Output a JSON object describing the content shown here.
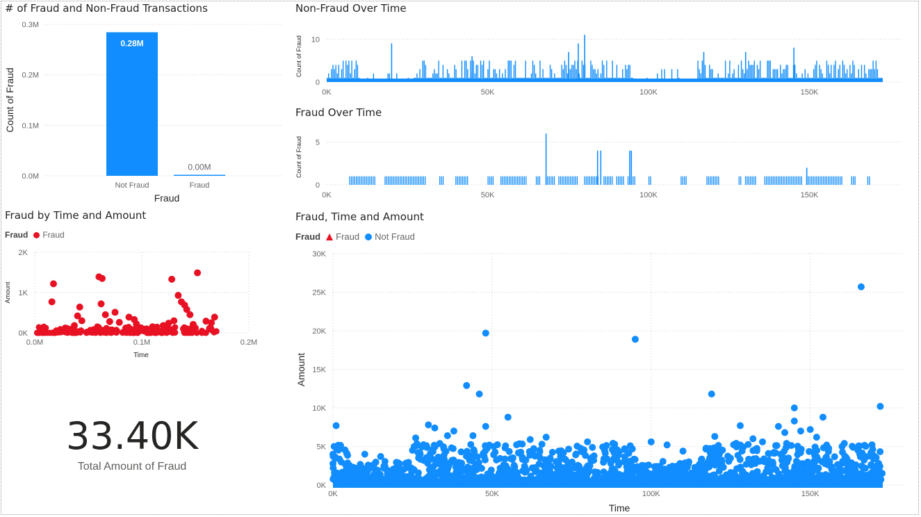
{
  "colors": {
    "blue": "#118dff",
    "red": "#e81123",
    "grid": "#c8c8c8"
  },
  "visuals": {
    "bar_title": "# of Fraud and Non-Fraud Transactions",
    "nonfraud_title": "Non-Fraud Over Time",
    "fraud_title": "Fraud Over Time",
    "fraud_scatter_title": "Fraud by Time and Amount",
    "main_scatter_title": "Fraud, Time and Amount"
  },
  "legend_small": {
    "title": "Fraud",
    "items": [
      {
        "label": "Fraud",
        "shape": "circle",
        "color": "#e81123"
      }
    ]
  },
  "legend_main": {
    "title": "Fraud",
    "items": [
      {
        "label": "Fraud",
        "shape": "triangle",
        "color": "#e81123"
      },
      {
        "label": "Not Fraud",
        "shape": "circle",
        "color": "#118dff"
      }
    ]
  },
  "kpi": {
    "value": "33.40K",
    "label": "Total Amount of Fraud"
  },
  "chart_data": [
    {
      "id": "bar",
      "type": "bar",
      "title": "# of Fraud and Non-Fraud Transactions",
      "categories": [
        "Not Fraud",
        "Fraud"
      ],
      "values": [
        284315,
        492
      ],
      "data_labels": [
        "0.28M",
        "0.00M"
      ],
      "xlabel": "Fraud",
      "ylabel": "Count of Fraud",
      "ylim": [
        0,
        300000
      ],
      "yticks": [
        {
          "v": 0,
          "t": "0.0M"
        },
        {
          "v": 100000,
          "t": "0.1M"
        },
        {
          "v": 200000,
          "t": "0.2M"
        },
        {
          "v": 300000,
          "t": "0.3M"
        }
      ],
      "grid": true
    },
    {
      "id": "nonfraud",
      "type": "bar",
      "title": "Non-Fraud Over Time",
      "xlabel": "",
      "ylabel": "Count of Fraud",
      "xlim": [
        0,
        172792
      ],
      "ylim": [
        0,
        12
      ],
      "xticks": [
        {
          "v": 0,
          "t": "0K"
        },
        {
          "v": 50000,
          "t": "50K"
        },
        {
          "v": 100000,
          "t": "100K"
        },
        {
          "v": 150000,
          "t": "150K"
        }
      ],
      "yticks": [
        {
          "v": 0,
          "t": "0"
        },
        {
          "v": 10,
          "t": "10"
        }
      ],
      "spikes": [
        [
          20000,
          9
        ],
        [
          80000,
          11
        ],
        [
          78000,
          9
        ],
        [
          145000,
          8
        ],
        [
          130000,
          7
        ],
        [
          117000,
          7
        ],
        [
          75000,
          7
        ],
        [
          45000,
          6
        ]
      ],
      "grid": true
    },
    {
      "id": "fraud",
      "type": "bar",
      "title": "Fraud Over Time",
      "xlabel": "",
      "ylabel": "Count of Fraud",
      "xlim": [
        0,
        172792
      ],
      "ylim": [
        0,
        6.5
      ],
      "xticks": [
        {
          "v": 0,
          "t": "0K"
        },
        {
          "v": 50000,
          "t": "50K"
        },
        {
          "v": 100000,
          "t": "100K"
        },
        {
          "v": 150000,
          "t": "150K"
        }
      ],
      "yticks": [
        {
          "v": 0,
          "t": "0"
        },
        {
          "v": 5,
          "t": "5"
        }
      ],
      "clusters": [
        [
          7000,
          15000
        ],
        [
          18000,
          31000
        ],
        [
          35000,
          36500
        ],
        [
          40000,
          44000
        ],
        [
          50000,
          52000
        ],
        [
          54000,
          62000
        ],
        [
          65000,
          66500
        ],
        [
          68000,
          71000
        ],
        [
          72000,
          78000
        ],
        [
          80000,
          84500
        ],
        [
          86000,
          89000
        ],
        [
          90000,
          92500
        ],
        [
          93500,
          96000
        ],
        [
          100000,
          101000
        ],
        [
          110000,
          112000
        ],
        [
          118000,
          122000
        ],
        [
          128000,
          129000
        ],
        [
          130000,
          133500
        ],
        [
          136000,
          147500
        ],
        [
          149000,
          160000
        ],
        [
          163000,
          164500
        ],
        [
          168000,
          169000
        ]
      ],
      "spikes": [
        [
          68000,
          6
        ],
        [
          84000,
          4
        ],
        [
          85000,
          4
        ],
        [
          94000,
          4
        ],
        [
          94500,
          4
        ],
        [
          149000,
          2
        ]
      ],
      "grid": true
    },
    {
      "id": "fraud_scatter",
      "type": "scatter",
      "title": "Fraud by Time and Amount",
      "series": [
        {
          "name": "Fraud"
        }
      ],
      "xlabel": "Time",
      "ylabel": "Amount",
      "xlim": [
        0,
        200000
      ],
      "ylim": [
        0,
        2000
      ],
      "xticks": [
        {
          "v": 0,
          "t": "0.0M"
        },
        {
          "v": 100000,
          "t": "0.1M"
        },
        {
          "v": 200000,
          "t": "0.2M"
        }
      ],
      "yticks": [
        {
          "v": 0,
          "t": "0K"
        },
        {
          "v": 1000,
          "t": "1K"
        },
        {
          "v": 2000,
          "t": "2K"
        }
      ],
      "points": [
        [
          17500,
          1218
        ],
        [
          16000,
          770
        ],
        [
          42000,
          640
        ],
        [
          60000,
          1390
        ],
        [
          63000,
          1350
        ],
        [
          62000,
          720
        ],
        [
          75000,
          510
        ],
        [
          88000,
          390
        ],
        [
          128000,
          1330
        ],
        [
          134000,
          930
        ],
        [
          137000,
          770
        ],
        [
          140000,
          690
        ],
        [
          152000,
          1490
        ],
        [
          145000,
          450
        ],
        [
          168000,
          390
        ],
        [
          160000,
          290
        ],
        [
          40000,
          420
        ],
        [
          37000,
          180
        ],
        [
          70000,
          280
        ],
        [
          95000,
          220
        ],
        [
          110000,
          150
        ],
        [
          85000,
          120
        ],
        [
          130000,
          300
        ],
        [
          120000,
          180
        ],
        [
          150000,
          120
        ],
        [
          5000,
          60
        ],
        [
          55000,
          80
        ],
        [
          102000,
          90
        ],
        [
          115000,
          60
        ],
        [
          148000,
          210
        ],
        [
          66000,
          450
        ],
        [
          79000,
          260
        ],
        [
          44000,
          300
        ],
        [
          20000,
          40
        ],
        [
          30000,
          110
        ],
        [
          93000,
          330
        ],
        [
          125000,
          240
        ],
        [
          142000,
          580
        ],
        [
          165000,
          250
        ]
      ],
      "cluster_ranges": [
        [
          2000,
          170000
        ]
      ],
      "grid": true
    },
    {
      "id": "main_scatter",
      "type": "scatter",
      "title": "Fraud, Time and Amount",
      "series": [
        {
          "name": "Fraud"
        },
        {
          "name": "Not Fraud"
        }
      ],
      "xlabel": "Time",
      "ylabel": "Amount",
      "xlim": [
        0,
        172792
      ],
      "ylim": [
        0,
        30000
      ],
      "xticks": [
        {
          "v": 0,
          "t": "0K"
        },
        {
          "v": 50000,
          "t": "50K"
        },
        {
          "v": 100000,
          "t": "100K"
        },
        {
          "v": 150000,
          "t": "150K"
        }
      ],
      "yticks": [
        {
          "v": 0,
          "t": "0K"
        },
        {
          "v": 5000,
          "t": "5K"
        },
        {
          "v": 10000,
          "t": "10K"
        },
        {
          "v": 15000,
          "t": "15K"
        },
        {
          "v": 20000,
          "t": "20K"
        },
        {
          "v": 25000,
          "t": "25K"
        },
        {
          "v": 30000,
          "t": "30K"
        }
      ],
      "points": [
        [
          166000,
          25700
        ],
        [
          48000,
          19700
        ],
        [
          95000,
          18900
        ],
        [
          42000,
          12900
        ],
        [
          46000,
          11800
        ],
        [
          119000,
          11800
        ],
        [
          172000,
          10200
        ],
        [
          145000,
          10000
        ],
        [
          55000,
          8800
        ],
        [
          154000,
          8800
        ],
        [
          1000,
          7700
        ],
        [
          30000,
          7800
        ],
        [
          48000,
          7600
        ],
        [
          128000,
          7700
        ],
        [
          140000,
          7600
        ],
        [
          145000,
          8300
        ],
        [
          150000,
          7200
        ],
        [
          147000,
          7000
        ],
        [
          32000,
          7400
        ],
        [
          38000,
          7000
        ],
        [
          36000,
          6400
        ],
        [
          44000,
          6400
        ],
        [
          26000,
          6100
        ],
        [
          67000,
          6200
        ],
        [
          80000,
          5600
        ],
        [
          100000,
          5600
        ],
        [
          105000,
          5200
        ],
        [
          120000,
          6300
        ],
        [
          132000,
          6000
        ],
        [
          152000,
          6200
        ],
        [
          160000,
          5000
        ],
        [
          0,
          4000
        ],
        [
          10000,
          4000
        ],
        [
          15000,
          3700
        ],
        [
          25000,
          4500
        ],
        [
          62000,
          5900
        ],
        [
          88000,
          5400
        ],
        [
          110000,
          4400
        ],
        [
          135000,
          5600
        ],
        [
          142000,
          6800
        ],
        [
          165000,
          4500
        ],
        [
          170000,
          3800
        ]
      ],
      "grid": true
    }
  ]
}
